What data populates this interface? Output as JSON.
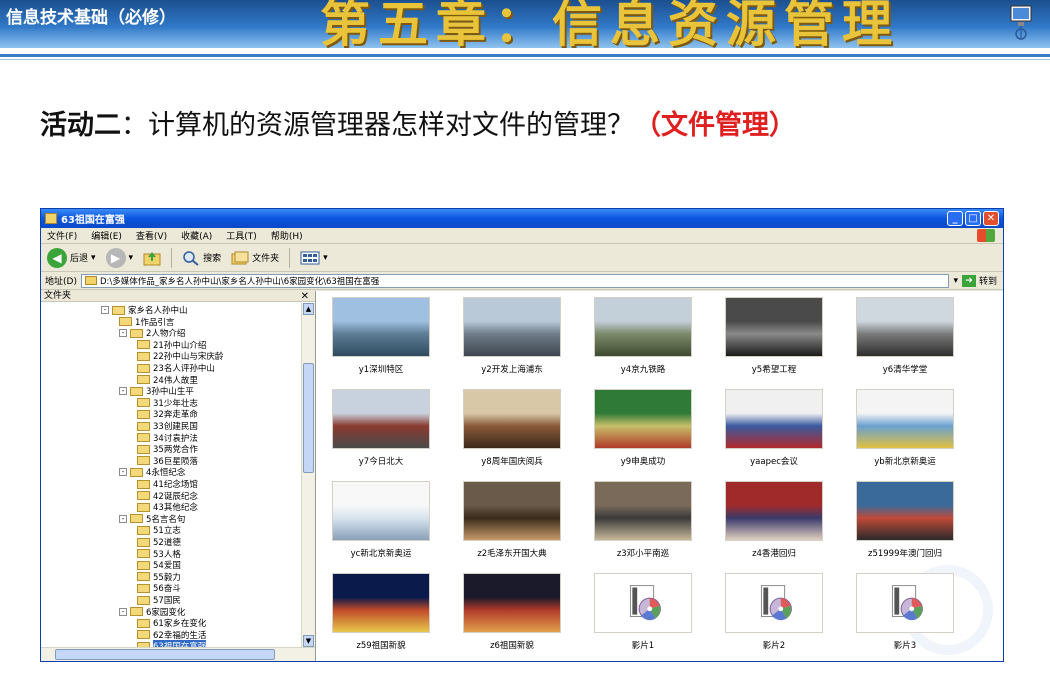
{
  "slide": {
    "course_title": "信息技术基础（必修）",
    "chapter_title": "第五章：信息资源管理",
    "activity_label": "活动二",
    "activity_question": "：计算机的资源管理器怎样对文件的管理？",
    "activity_highlight": "（文件管理）"
  },
  "window": {
    "title": "63祖国在富强",
    "menu": [
      "文件(F)",
      "编辑(E)",
      "查看(V)",
      "收藏(A)",
      "工具(T)",
      "帮助(H)"
    ],
    "toolbar": {
      "back": "后退",
      "search": "搜索",
      "folders": "文件夹"
    },
    "address": {
      "label": "地址(D)",
      "path": "D:\\多媒体作品_家乡名人孙中山\\家乡名人孙中山\\6家园变化\\63祖国在富强",
      "go": "转到"
    },
    "tree_title": "文件夹",
    "tree": [
      {
        "label": "家乡名人孙中山",
        "level": 0,
        "expander": "⊟"
      },
      {
        "label": "1作品引言",
        "level": 1,
        "expander": ""
      },
      {
        "label": "2人物介绍",
        "level": 1,
        "expander": "⊟"
      },
      {
        "label": "21孙中山介绍",
        "level": 2,
        "expander": ""
      },
      {
        "label": "22孙中山与宋庆龄",
        "level": 2,
        "expander": ""
      },
      {
        "label": "23名人评孙中山",
        "level": 2,
        "expander": ""
      },
      {
        "label": "24伟人故里",
        "level": 2,
        "expander": ""
      },
      {
        "label": "3孙中山生平",
        "level": 1,
        "expander": "⊟"
      },
      {
        "label": "31少年壮志",
        "level": 2,
        "expander": ""
      },
      {
        "label": "32奔走革命",
        "level": 2,
        "expander": ""
      },
      {
        "label": "33创建民国",
        "level": 2,
        "expander": ""
      },
      {
        "label": "34讨袁护法",
        "level": 2,
        "expander": ""
      },
      {
        "label": "35两党合作",
        "level": 2,
        "expander": ""
      },
      {
        "label": "36巨星陨落",
        "level": 2,
        "expander": ""
      },
      {
        "label": "4永恒纪念",
        "level": 1,
        "expander": "⊟"
      },
      {
        "label": "41纪念场馆",
        "level": 2,
        "expander": ""
      },
      {
        "label": "42诞辰纪念",
        "level": 2,
        "expander": ""
      },
      {
        "label": "43其他纪念",
        "level": 2,
        "expander": ""
      },
      {
        "label": "5名言名句",
        "level": 1,
        "expander": "⊟"
      },
      {
        "label": "51立志",
        "level": 2,
        "expander": ""
      },
      {
        "label": "52道德",
        "level": 2,
        "expander": ""
      },
      {
        "label": "53人格",
        "level": 2,
        "expander": ""
      },
      {
        "label": "54爱国",
        "level": 2,
        "expander": ""
      },
      {
        "label": "55毅力",
        "level": 2,
        "expander": ""
      },
      {
        "label": "56奋斗",
        "level": 2,
        "expander": ""
      },
      {
        "label": "57国民",
        "level": 2,
        "expander": ""
      },
      {
        "label": "6家园变化",
        "level": 1,
        "expander": "⊟"
      },
      {
        "label": "61家乡在变化",
        "level": 2,
        "expander": ""
      },
      {
        "label": "62幸福的生活",
        "level": 2,
        "expander": ""
      },
      {
        "label": "63祖国在富强",
        "level": 2,
        "expander": "",
        "selected": true
      }
    ],
    "files": [
      {
        "name": "y1深圳特区",
        "kind": "photo",
        "palette": [
          "#9fc0e0",
          "#5d7d96",
          "#2f4b5e"
        ]
      },
      {
        "name": "y2开发上海浦东",
        "kind": "photo",
        "palette": [
          "#b9c9d8",
          "#6f7c88",
          "#3d4650"
        ]
      },
      {
        "name": "y4京九铁路",
        "kind": "photo",
        "palette": [
          "#c3cfd9",
          "#7c8a6a",
          "#3d4a2f"
        ]
      },
      {
        "name": "y5希望工程",
        "kind": "photo",
        "palette": [
          "#4a4a4a",
          "#8a8a8a",
          "#1a1a1a"
        ]
      },
      {
        "name": "y6清华学堂",
        "kind": "photo",
        "palette": [
          "#cfd7df",
          "#7a7a7a",
          "#2e2e2e"
        ]
      },
      {
        "name": "y7今日北大",
        "kind": "photo",
        "palette": [
          "#c8d2de",
          "#8b3a30",
          "#4a4a4a"
        ]
      },
      {
        "name": "y8周年国庆阅兵",
        "kind": "photo",
        "palette": [
          "#d8c8a8",
          "#8a5a3a",
          "#3a2a1a"
        ]
      },
      {
        "name": "y9申奥成功",
        "kind": "photo",
        "palette": [
          "#2e7a36",
          "#c8c06a",
          "#b23a2a"
        ]
      },
      {
        "name": "yaapec会议",
        "kind": "photo",
        "palette": [
          "#f0f0f0",
          "#3a5aa0",
          "#b02a2a"
        ]
      },
      {
        "name": "yb新北京新奥运",
        "kind": "photo",
        "palette": [
          "#f4f4f4",
          "#6aa0d0",
          "#e0c040"
        ]
      },
      {
        "name": "yc新北京新奥运",
        "kind": "photo",
        "palette": [
          "#f8f8f8",
          "#d8e4ee",
          "#8aa0b8"
        ]
      },
      {
        "name": "z2毛泽东开国大典",
        "kind": "photo",
        "palette": [
          "#6a5a4a",
          "#3a2a1a",
          "#c89a6a"
        ]
      },
      {
        "name": "z3邓小平南巡",
        "kind": "photo",
        "palette": [
          "#7a6a5a",
          "#3a3a3a",
          "#c8b89a"
        ]
      },
      {
        "name": "z4香港回归",
        "kind": "photo",
        "palette": [
          "#a02a2a",
          "#3a3a6a",
          "#e0d0c0"
        ]
      },
      {
        "name": "z51999年澳门回归",
        "kind": "photo",
        "palette": [
          "#3a6a9a",
          "#c04a3a",
          "#2a2a2a"
        ]
      },
      {
        "name": "z59祖国新貌",
        "kind": "photo",
        "palette": [
          "#0a1a4a",
          "#c04a2a",
          "#e8c84a"
        ]
      },
      {
        "name": "z6祖国新貌",
        "kind": "photo",
        "palette": [
          "#1a1a2a",
          "#b03a2a",
          "#e0a04a"
        ]
      },
      {
        "name": "影片1",
        "kind": "video"
      },
      {
        "name": "影片2",
        "kind": "video"
      },
      {
        "name": "影片3",
        "kind": "video"
      }
    ]
  }
}
